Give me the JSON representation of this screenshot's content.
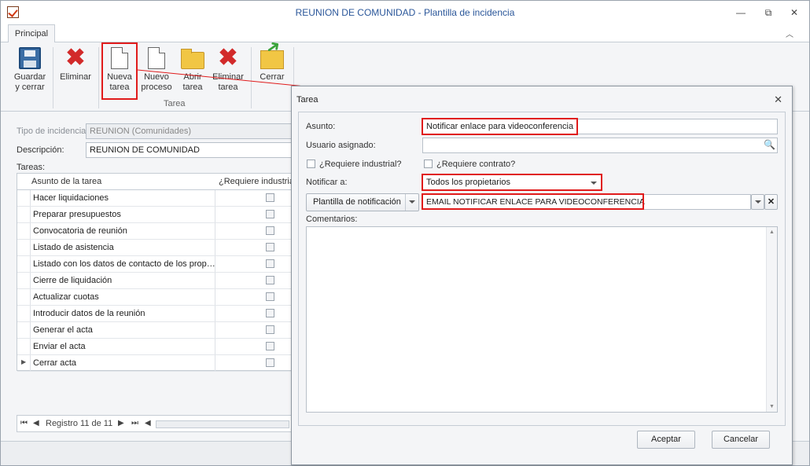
{
  "window": {
    "title": "REUNION DE COMUNIDAD - Plantilla de incidencia",
    "minimize_glyph": "—",
    "restore_glyph": "⧉",
    "close_glyph": "✕"
  },
  "tabs": [
    {
      "label": "Principal"
    }
  ],
  "ribbon": {
    "buttons": {
      "guardar_line1": "Guardar",
      "guardar_line2": "y cerrar",
      "eliminar": "Eliminar",
      "nueva_tarea_line1": "Nueva",
      "nueva_tarea_line2": "tarea",
      "nuevo_proceso_line1": "Nuevo",
      "nuevo_proceso_line2": "proceso",
      "abrir_tarea_line1": "Abrir",
      "abrir_tarea_line2": "tarea",
      "eliminar_tarea_line1": "Eliminar",
      "eliminar_tarea_line2": "tarea",
      "cerrar": "Cerrar"
    },
    "group_tarea": "Tarea"
  },
  "form": {
    "tipo_label": "Tipo de incidencia",
    "tipo_value": "REUNION (Comunidades)",
    "descripcion_label": "Descripción:",
    "descripcion_value": "REUNION DE COMUNIDAD",
    "tareas_label": "Tareas:"
  },
  "grid": {
    "col_asunto": "Asunto de la tarea",
    "col_industrial": "¿Requiere industrial?",
    "rows": [
      {
        "asunto": "Hacer liquidaciones"
      },
      {
        "asunto": "Preparar presupuestos"
      },
      {
        "asunto": "Convocatoria de reunión"
      },
      {
        "asunto": "Listado de asistencia"
      },
      {
        "asunto": "Listado con los datos de contacto de los propietarios"
      },
      {
        "asunto": "Cierre de liquidación"
      },
      {
        "asunto": "Actualizar cuotas"
      },
      {
        "asunto": "Introducir datos de la reunión"
      },
      {
        "asunto": "Generar el acta"
      },
      {
        "asunto": "Enviar el acta"
      },
      {
        "asunto": "Cerrar acta"
      }
    ],
    "navigator_text": "Registro 11 de 11"
  },
  "dialog": {
    "title": "Tarea",
    "asunto_label": "Asunto:",
    "asunto_value": "Notificar enlace para videoconferencia",
    "usuario_label": "Usuario asignado:",
    "usuario_value": "",
    "industrial_label": "¿Requiere industrial?",
    "contrato_label": "¿Requiere contrato?",
    "notificar_label": "Notificar a:",
    "notificar_value": "Todos los propietarios",
    "plantilla_button": "Plantilla de notificación",
    "plantilla_value": "EMAIL NOTIFICAR ENLACE PARA VIDEOCONFERENCIA",
    "comentarios_label": "Comentarios:",
    "aceptar": "Aceptar",
    "cancelar": "Cancelar"
  },
  "colors": {
    "highlight": "#e01b1b",
    "title_text": "#2b579a"
  }
}
